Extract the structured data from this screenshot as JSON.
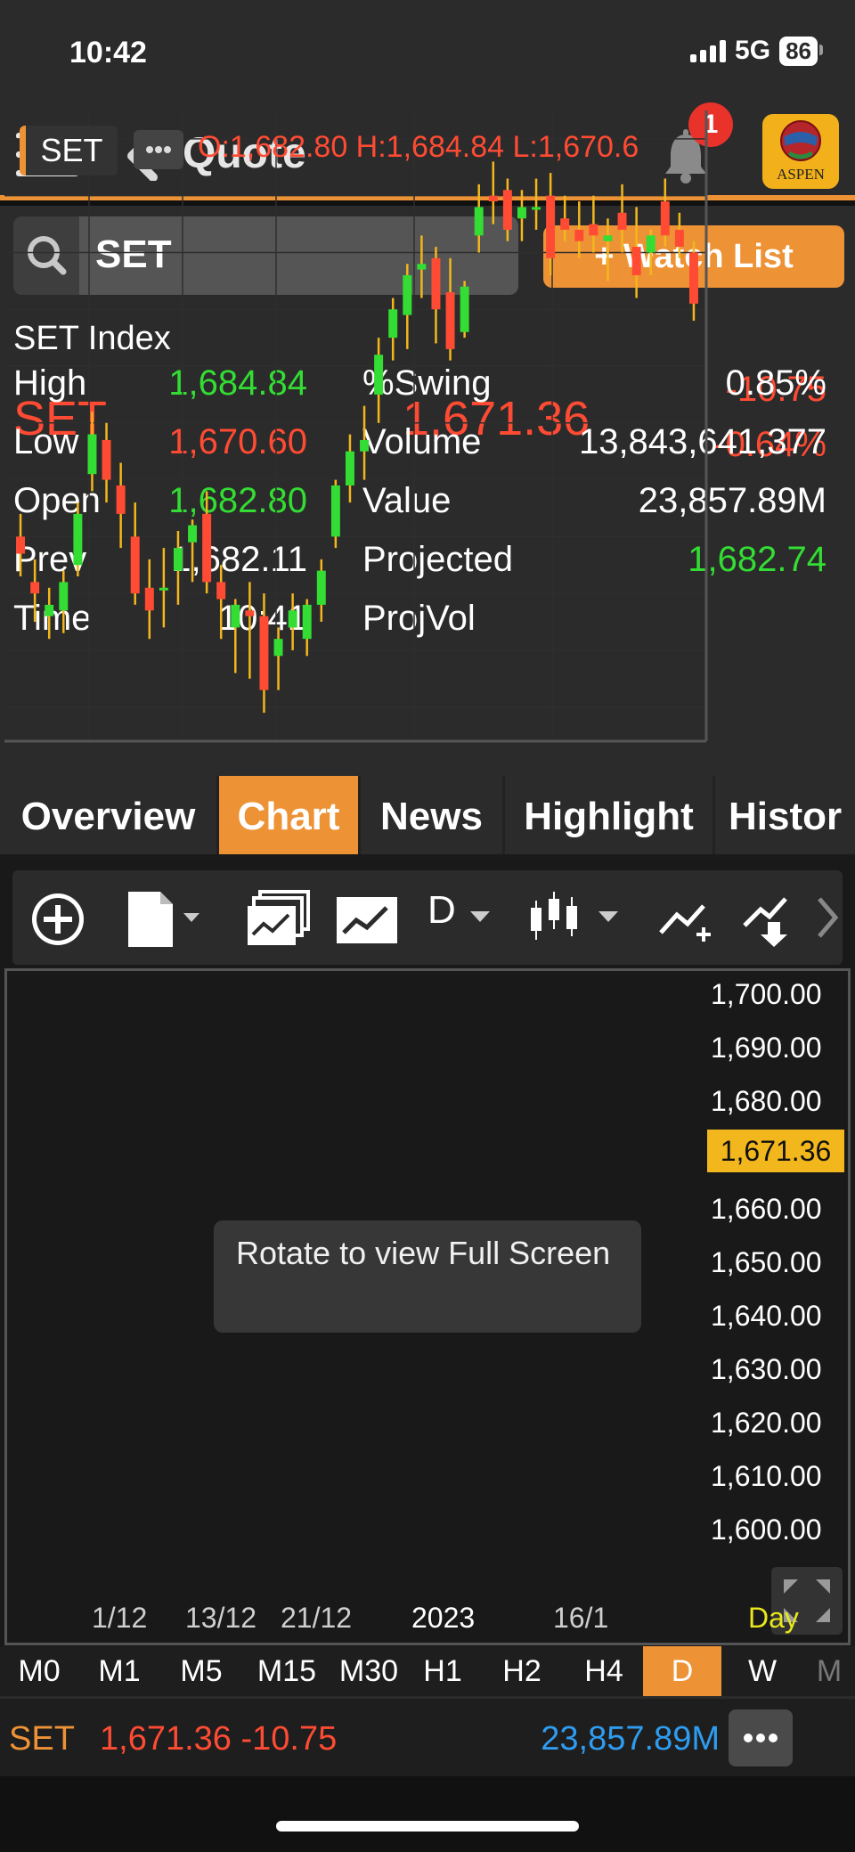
{
  "status": {
    "time": "10:42",
    "network": "5G",
    "battery": "86"
  },
  "nav": {
    "title": "Quote",
    "badge": "1",
    "logo_text": "ASPEN"
  },
  "search": {
    "value": "SET"
  },
  "watchlist_label": "+ Watch List",
  "quote": {
    "index_name": "SET Index",
    "symbol": "SET",
    "last": "1,671.36",
    "change": "-10.75",
    "change_pct": "-0.64%",
    "high_label": "High",
    "high": "1,684.84",
    "low_label": "Low",
    "low": "1,670.60",
    "open_label": "Open",
    "open": "1,682.80",
    "prev_label": "Prev",
    "prev": "1,682.11",
    "time_label": "Time",
    "time": "10:41",
    "swing_label": "%Swing",
    "swing": "0.85%",
    "volume_label": "Volume",
    "volume": "13,843,641,377",
    "value_label": "Value",
    "value": "23,857.89M",
    "projected_label": "Projected",
    "projected": "1,682.74",
    "projvol_label": "ProjVol"
  },
  "tabs": [
    "Overview",
    "Chart",
    "News",
    "Highlight",
    "Histor"
  ],
  "toolbar": {
    "period_label": "D"
  },
  "chart": {
    "symbol_badge": "SET",
    "ohlc": "O:1,682.80  H:1,684.84  L:1,670.6",
    "current_price": "1,671.36",
    "tooltip": "Rotate to view Full Screen",
    "period_label": "Day",
    "x_ticks": [
      "1/12",
      "13/12",
      "21/12",
      "2023",
      "16/1"
    ]
  },
  "periods": [
    "M0",
    "M1",
    "M5",
    "M15",
    "M30",
    "H1",
    "H2",
    "H4",
    "D",
    "W",
    "M"
  ],
  "ticker": {
    "symbol": "SET",
    "last_change": "1,671.36 -10.75",
    "value": "23,857.89M"
  },
  "colors": {
    "accent": "#ee9236",
    "up": "#33dd33",
    "down": "#ff4b33",
    "last_price": "#f2b71c",
    "value_blue": "#2e9cf0"
  },
  "chart_data": {
    "type": "candlestick",
    "y_ticks": [
      "1,700.00",
      "1,690.00",
      "1,680.00",
      "1,660.00",
      "1,650.00",
      "1,640.00",
      "1,630.00",
      "1,620.00",
      "1,610.00",
      "1,600.00"
    ],
    "ylim": [
      1594,
      1705
    ],
    "candles": [
      [
        1630,
        1634,
        1623,
        1627
      ],
      [
        1622,
        1626,
        1615,
        1620
      ],
      [
        1616,
        1621,
        1612,
        1618
      ],
      [
        1617,
        1624,
        1613,
        1622
      ],
      [
        1625,
        1636,
        1623,
        1634
      ],
      [
        1641,
        1652,
        1638,
        1648
      ],
      [
        1647,
        1650,
        1636,
        1640
      ],
      [
        1639,
        1643,
        1628,
        1634
      ],
      [
        1630,
        1636,
        1618,
        1620
      ],
      [
        1621,
        1626,
        1612,
        1617
      ],
      [
        1621,
        1628,
        1614,
        1621
      ],
      [
        1624,
        1631,
        1618,
        1628
      ],
      [
        1629,
        1633,
        1622,
        1632
      ],
      [
        1634,
        1638,
        1620,
        1622
      ],
      [
        1622,
        1625,
        1612,
        1619
      ],
      [
        1614,
        1619,
        1606,
        1618
      ],
      [
        1617,
        1622,
        1605,
        1616
      ],
      [
        1616,
        1620,
        1599,
        1603
      ],
      [
        1609,
        1614,
        1603,
        1612
      ],
      [
        1614,
        1620,
        1610,
        1617
      ],
      [
        1612,
        1619,
        1609,
        1618
      ],
      [
        1618,
        1626,
        1615,
        1624
      ],
      [
        1630,
        1640,
        1628,
        1639
      ],
      [
        1639,
        1648,
        1636,
        1645
      ],
      [
        1645,
        1653,
        1640,
        1647
      ],
      [
        1655,
        1665,
        1650,
        1662
      ],
      [
        1665,
        1672,
        1661,
        1670
      ],
      [
        1669,
        1678,
        1663,
        1676
      ],
      [
        1677,
        1683,
        1672,
        1678
      ],
      [
        1679,
        1681,
        1664,
        1670
      ],
      [
        1673,
        1679,
        1661,
        1663
      ],
      [
        1666,
        1675,
        1665,
        1674
      ],
      [
        1683,
        1692,
        1680,
        1688
      ],
      [
        1690,
        1696,
        1685,
        1689
      ],
      [
        1691,
        1693,
        1682,
        1684
      ],
      [
        1686,
        1691,
        1682,
        1688
      ],
      [
        1688,
        1693,
        1684,
        1688
      ],
      [
        1690,
        1694,
        1676,
        1679
      ],
      [
        1686,
        1690,
        1682,
        1684
      ],
      [
        1684,
        1689,
        1679,
        1682
      ],
      [
        1685,
        1690,
        1680,
        1683
      ],
      [
        1682,
        1686,
        1675,
        1683
      ],
      [
        1687,
        1692,
        1680,
        1684
      ],
      [
        1681,
        1688,
        1672,
        1676
      ],
      [
        1680,
        1684,
        1676,
        1683
      ],
      [
        1689,
        1693,
        1681,
        1683
      ],
      [
        1684,
        1687,
        1679,
        1681
      ],
      [
        1680,
        1682,
        1668,
        1671
      ]
    ]
  }
}
